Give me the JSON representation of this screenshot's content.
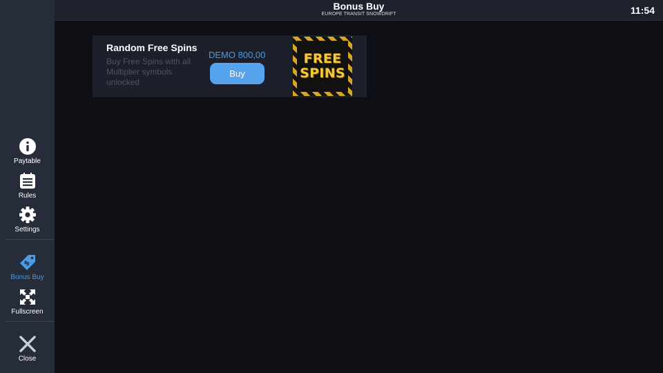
{
  "header": {
    "title": "Bonus Buy",
    "subtitle": "EUROPE TRANSIT SNOWDRIFT",
    "clock": "11:54"
  },
  "sidebar": {
    "items": [
      {
        "label": "Paytable",
        "icon": "info-icon"
      },
      {
        "label": "Rules",
        "icon": "rules-list-icon"
      },
      {
        "label": "Settings",
        "icon": "gear-icon"
      },
      {
        "label": "Bonus Buy",
        "icon": "price-tag-icon",
        "active": true
      },
      {
        "label": "Fullscreen",
        "icon": "fullscreen-icon"
      },
      {
        "label": "Close",
        "icon": "close-icon"
      }
    ],
    "active_color": "#4b9be6"
  },
  "bonus": {
    "title": "Random Free Spins",
    "description": "Buy Free Spins with all Multiplier symbols unlocked",
    "price": "DEMO 800,00",
    "buy_label": "Buy",
    "badge_line1": "FREE",
    "badge_line2": "SPINS"
  },
  "colors": {
    "background": "#0d0f14",
    "sidebar": "#262c3a",
    "accent": "#4b9be6",
    "button": "#56a3ee",
    "badge_gold": "#f4c83a"
  }
}
